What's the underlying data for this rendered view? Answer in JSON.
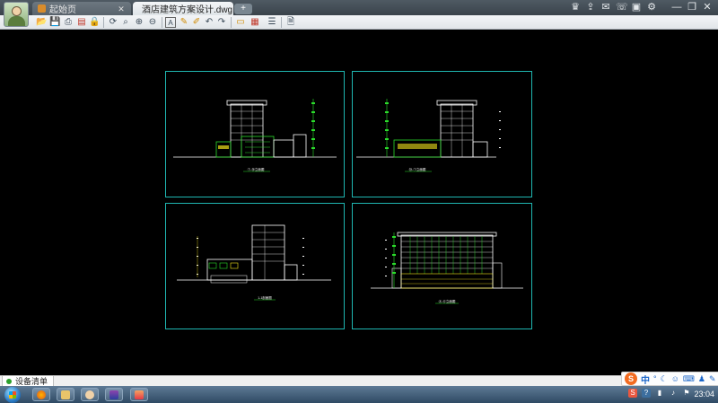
{
  "tabs": [
    {
      "label": "起始页",
      "active": false
    },
    {
      "label": "酒店建筑方案设计.dwg",
      "active": true
    }
  ],
  "new_tab_symbol": "+",
  "window_icons": [
    "crown-icon",
    "share-icon",
    "mail-icon",
    "phone-icon",
    "skin-icon",
    "settings-icon",
    "minimize-icon",
    "restore-icon"
  ],
  "toolbar": {
    "buttons": [
      "open-icon",
      "save-icon",
      "print-icon",
      "export-pdf-icon",
      "lock-icon",
      "rotate-icon",
      "zoom-window-icon",
      "zoom-in-icon",
      "zoom-out-icon",
      "text-icon",
      "pencil-icon",
      "markup-icon",
      "undo-icon",
      "redo-icon",
      "measure-icon",
      "hatch-icon",
      "layers-icon",
      "document-icon"
    ]
  },
  "viewports": [
    {
      "name": "elevation-south",
      "caption": "①-⑩立面图"
    },
    {
      "name": "elevation-north",
      "caption": "⑩-①立面图"
    },
    {
      "name": "section",
      "caption": "1-1剖面图"
    },
    {
      "name": "elevation-front",
      "caption": "Ⓐ-Ⓖ立面图"
    }
  ],
  "document_strip": {
    "label": "设备清单"
  },
  "ime": {
    "logo": "S",
    "mode": "中"
  },
  "taskbar": {
    "apps": [
      "firefox-icon",
      "explorer-icon",
      "avatar-app-icon",
      "winrar-icon",
      "paint-icon"
    ],
    "clock": "23:04"
  },
  "colors": {
    "viewport_border": "#1fb6b1",
    "drawing_white": "#ffffff",
    "drawing_green": "#2bdc2b",
    "drawing_yellow": "#f2e21a"
  }
}
